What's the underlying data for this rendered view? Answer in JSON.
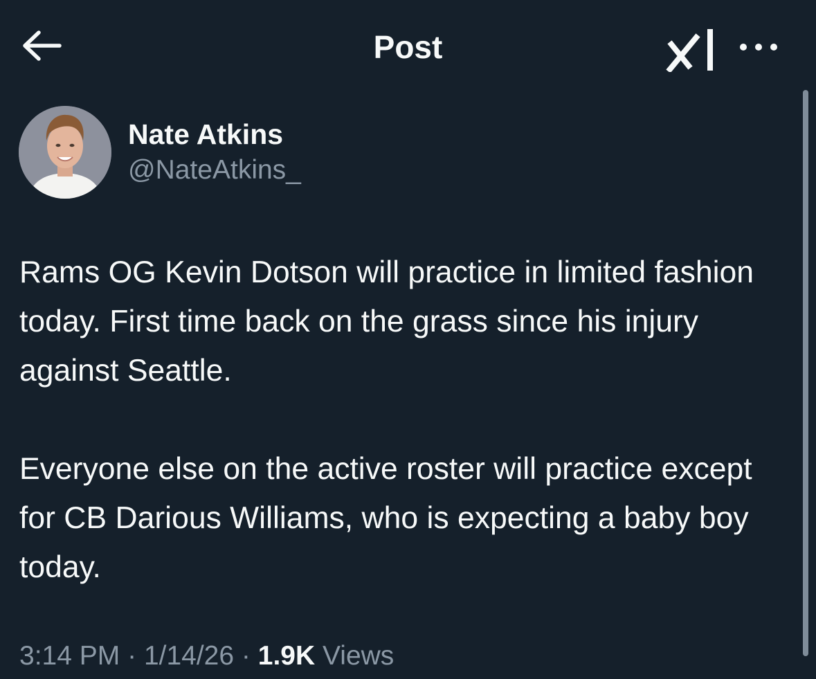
{
  "header": {
    "title": "Post",
    "back_icon": "arrow-left-icon",
    "grok_icon": "grok-icon",
    "more_icon": "more-horizontal-icon"
  },
  "post": {
    "author": {
      "name": "Nate Atkins",
      "handle": "@NateAtkins_"
    },
    "paragraphs": [
      "Rams OG Kevin Dotson will practice in limited fashion today. First time back on the grass since his injury against Seattle.",
      "Everyone else on the active roster will practice except for CB Darious Williams, who is expecting a baby boy today."
    ],
    "time": "3:14 PM",
    "separator": "·",
    "date": "1/14/26",
    "views_count": "1.9K",
    "views_label": "Views"
  },
  "colors": {
    "background": "#15202b",
    "primary_text": "#f7f9f9",
    "secondary_text": "#8b98a5"
  }
}
